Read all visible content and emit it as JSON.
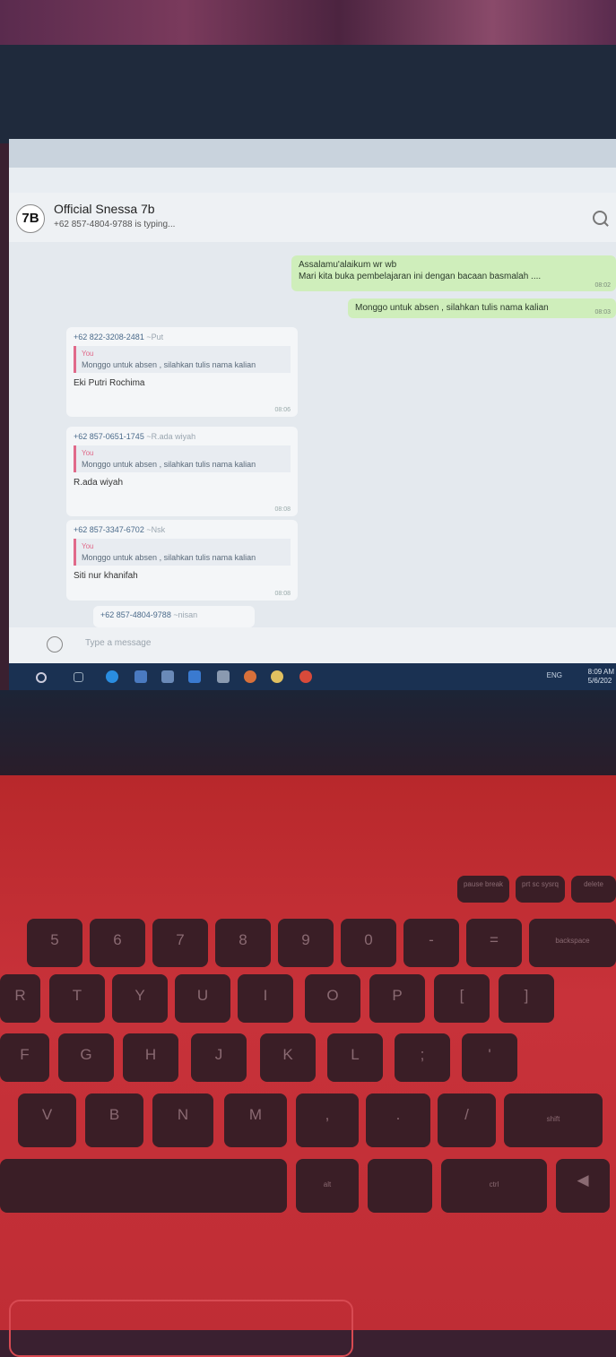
{
  "chat": {
    "title": "Official Snessa 7b",
    "status": "+62 857-4804-9788 is typing...",
    "avatar_text": "7B"
  },
  "messages_out": [
    {
      "line1": "Assalamu'alaikum wr wb",
      "line2": "Mari kita buka pembelajaran ini dengan bacaan basmalah ....",
      "time": "08:02"
    },
    {
      "text": "Monggo untuk absen , silahkan tulis nama kalian",
      "time": "08:03"
    }
  ],
  "messages_in": [
    {
      "sender": "+62 822-3208-2481",
      "alias": "~Put",
      "quote_author": "You",
      "quote": "Monggo untuk absen , silahkan tulis nama kalian",
      "text": "Eki Putri Rochima",
      "time": "08:06"
    },
    {
      "sender": "+62 857-0651-1745",
      "alias": "~R.ada wiyah",
      "quote_author": "You",
      "quote": "Monggo untuk absen , silahkan tulis nama kalian",
      "text": "R.ada wiyah",
      "time": "08:08"
    },
    {
      "sender": "+62 857-3347-6702",
      "alias": "~Nsk",
      "quote_author": "You",
      "quote": "Monggo untuk absen , silahkan tulis nama kalian",
      "text": "Siti nur khanifah",
      "time": "08:08"
    },
    {
      "sender": "+62 857-4804-9788",
      "alias": "~nisan"
    }
  ],
  "composer": {
    "placeholder": "Type a message"
  },
  "taskbar": {
    "tray_lang": "ENG",
    "time": "8:09 AM",
    "date": "5/6/202"
  },
  "keyboard": {
    "fn_row": [
      "pause break",
      "prt sc sysrq",
      "delete"
    ],
    "num_row": [
      "5",
      "6",
      "7",
      "8",
      "9",
      "0",
      "-",
      "=",
      "backspace"
    ],
    "top_row": [
      "R",
      "T",
      "Y",
      "U",
      "I",
      "O",
      "P",
      "[",
      "]"
    ],
    "home_row": [
      "F",
      "G",
      "H",
      "J",
      "K",
      "L",
      ";",
      "'"
    ],
    "bottom_row": [
      "V",
      "B",
      "N",
      "M",
      ",",
      ".",
      "/",
      "shift"
    ],
    "space_row": [
      "alt",
      "ctrl"
    ]
  }
}
